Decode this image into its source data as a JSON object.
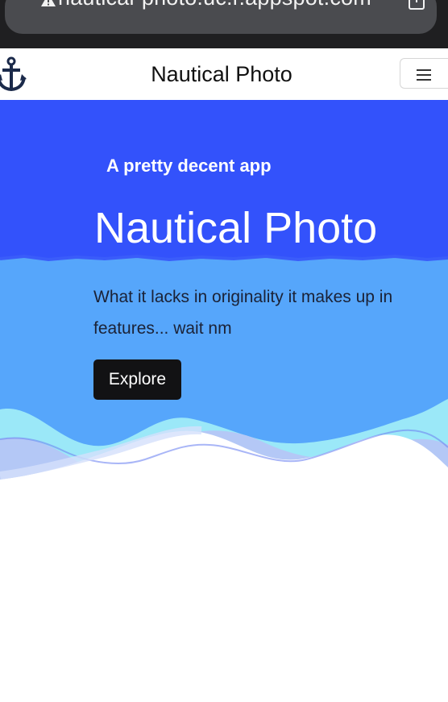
{
  "browser": {
    "url": "nautical-photo.uc.r.appspot.com",
    "warning_icon": "warning-triangle-icon",
    "share_icon": "share-icon"
  },
  "navbar": {
    "logo_icon": "anchor-icon",
    "brand": "Nautical Photo",
    "menu_icon": "hamburger-menu-icon"
  },
  "hero": {
    "eyebrow": "A pretty decent app",
    "title": "Nautical Photo",
    "description": "What it lacks in originality it makes up in features... wait nm",
    "button_label": "Explore"
  },
  "colors": {
    "hero_top": "#3352fb",
    "hero_mid": "#56a6fb",
    "wave_light": "#9be8f8",
    "wave_pale": "#d5e0fb",
    "button_bg": "#121214"
  }
}
